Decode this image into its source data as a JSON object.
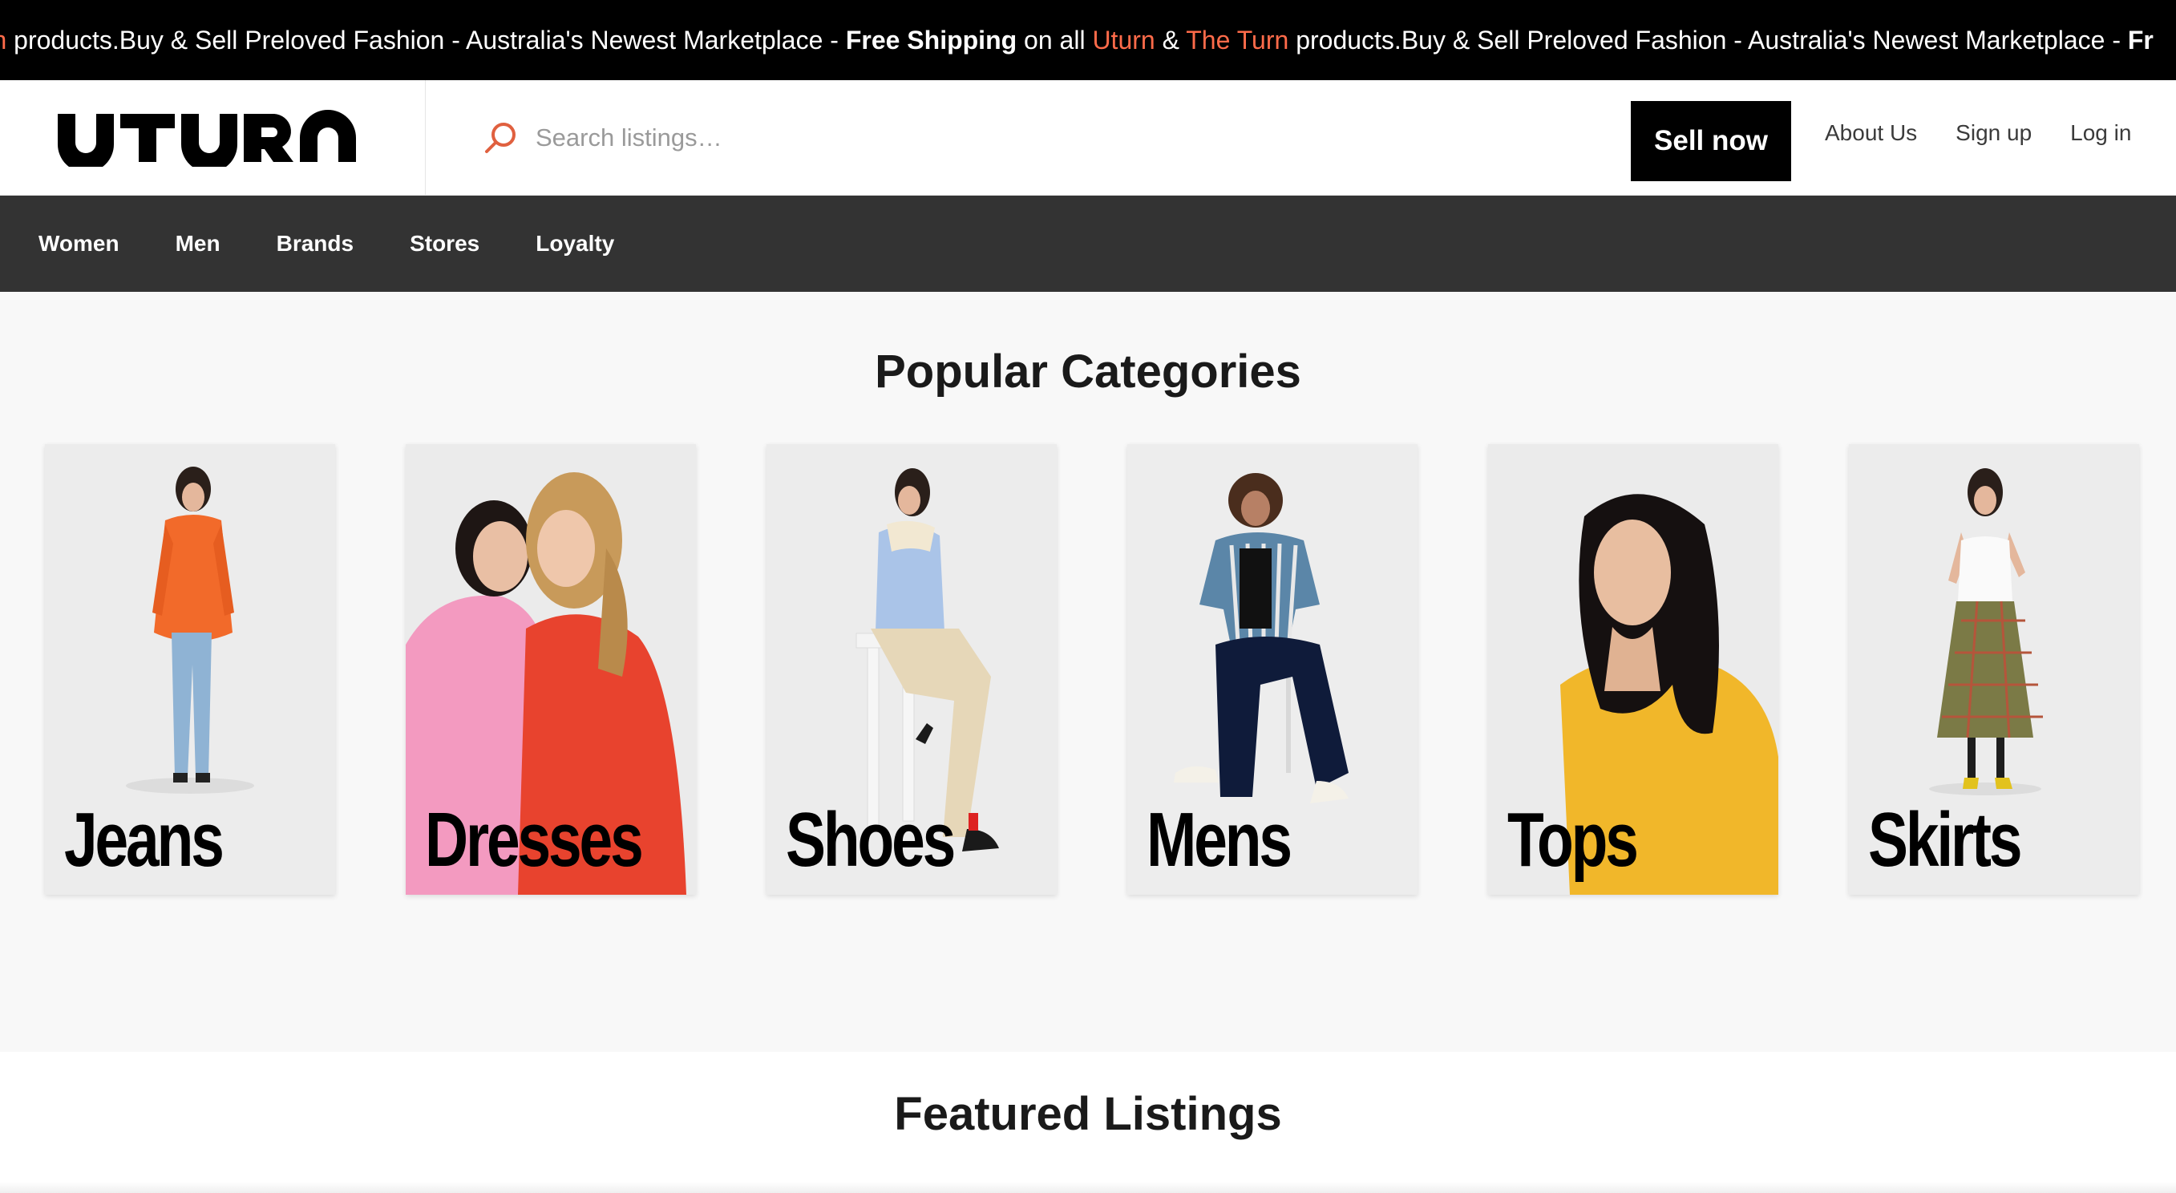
{
  "marquee": {
    "parts": [
      {
        "text": "urn",
        "accent": true,
        "bold": false
      },
      {
        "text": " products.Buy & Sell Preloved Fashion - Australia's Newest Marketplace - ",
        "accent": false,
        "bold": false
      },
      {
        "text": "Free Shipping",
        "accent": false,
        "bold": true
      },
      {
        "text": " on all ",
        "accent": false,
        "bold": false
      },
      {
        "text": "Uturn",
        "accent": true,
        "bold": false
      },
      {
        "text": " & ",
        "accent": false,
        "bold": false
      },
      {
        "text": "The Turn",
        "accent": true,
        "bold": false
      },
      {
        "text": " products.Buy & Sell Preloved Fashion - Australia's Newest Marketplace - ",
        "accent": false,
        "bold": false
      },
      {
        "text": "Fr",
        "accent": false,
        "bold": true
      }
    ],
    "accent_color": "#ff6b4a"
  },
  "header": {
    "logo_text": "UTURN",
    "search_placeholder": "Search listings…",
    "search_icon": "search-icon",
    "sell_label": "Sell now",
    "links": [
      "About Us",
      "Sign up",
      "Log in"
    ]
  },
  "nav": {
    "items": [
      "Women",
      "Men",
      "Brands",
      "Stores",
      "Loyalty"
    ]
  },
  "popular": {
    "title": "Popular Categories",
    "categories": [
      {
        "label": "Jeans",
        "scene": "model-orange-coat"
      },
      {
        "label": "Dresses",
        "scene": "two-models-pink-red"
      },
      {
        "label": "Shoes",
        "scene": "model-seated-stool"
      },
      {
        "label": "Mens",
        "scene": "man-seated-chair"
      },
      {
        "label": "Tops",
        "scene": "model-yellow-top"
      },
      {
        "label": "Skirts",
        "scene": "model-plaid-skirt"
      }
    ]
  },
  "featured": {
    "title": "Featured Listings"
  }
}
